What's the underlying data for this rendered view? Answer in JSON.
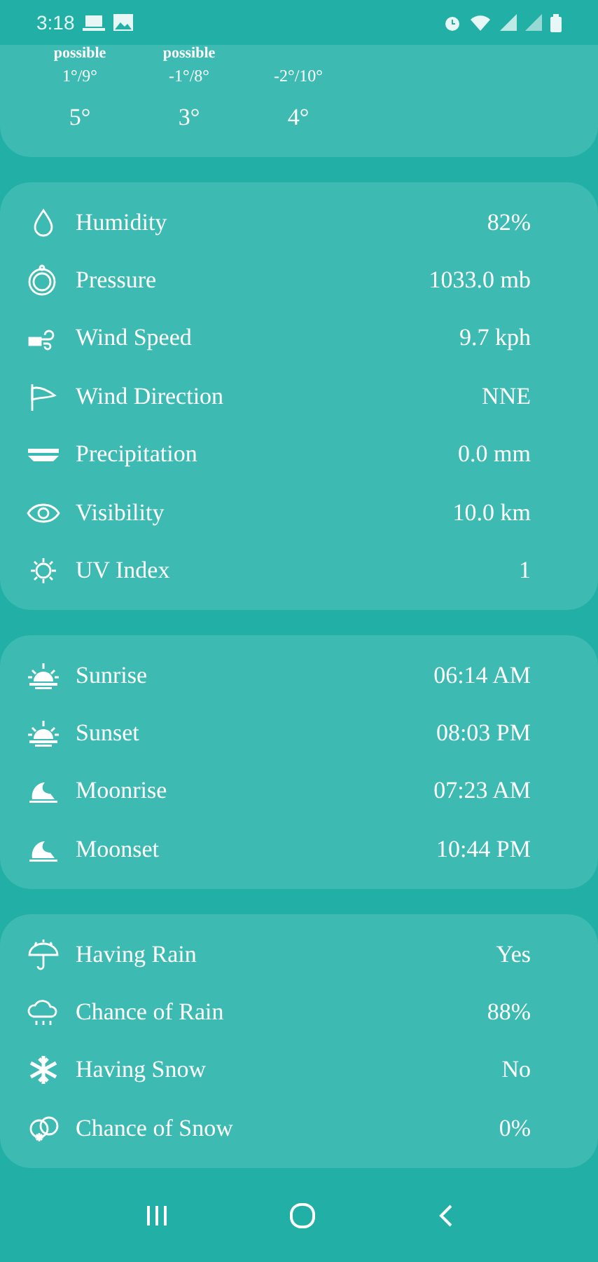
{
  "status_bar": {
    "time": "3:18"
  },
  "forecast": [
    {
      "condition": "possible",
      "range": "1°/9°",
      "temp": "5°"
    },
    {
      "condition": "possible",
      "range": "-1°/8°",
      "temp": "3°"
    },
    {
      "range": "-2°/10°",
      "temp": "4°"
    }
  ],
  "details": [
    {
      "label": "Humidity",
      "value": "82%"
    },
    {
      "label": "Pressure",
      "value": "1033.0 mb"
    },
    {
      "label": "Wind Speed",
      "value": "9.7 kph"
    },
    {
      "label": "Wind Direction",
      "value": "NNE"
    },
    {
      "label": "Precipitation",
      "value": "0.0 mm"
    },
    {
      "label": "Visibility",
      "value": "10.0 km"
    },
    {
      "label": "UV Index",
      "value": "1"
    }
  ],
  "astronomy": [
    {
      "label": "Sunrise",
      "value": "06:14 AM"
    },
    {
      "label": "Sunset",
      "value": "08:03 PM"
    },
    {
      "label": "Moonrise",
      "value": "07:23 AM"
    },
    {
      "label": "Moonset",
      "value": "10:44 PM"
    }
  ],
  "precipitation": [
    {
      "label": "Having Rain",
      "value": "Yes"
    },
    {
      "label": "Chance of Rain",
      "value": "88%"
    },
    {
      "label": "Having Snow",
      "value": "No"
    },
    {
      "label": "Chance of Snow",
      "value": "0%"
    }
  ]
}
